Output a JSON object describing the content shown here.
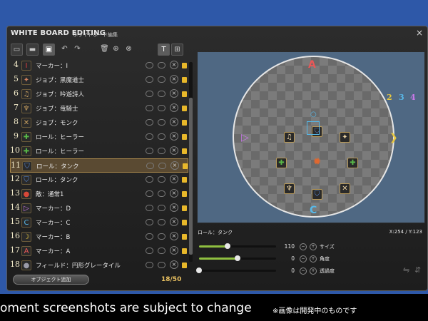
{
  "window": {
    "title_en": "WHITE BOARD EDITING",
    "title_jp": "ホワイトボード編集",
    "close_icon": "×"
  },
  "toolbar": {
    "icons": [
      "save-icon",
      "folder-icon",
      "floppy-icon",
      "undo-icon",
      "redo-icon",
      "trash-icon",
      "copy-icon",
      "paste-icon",
      "text-icon",
      "grid-icon"
    ],
    "text_label": "T"
  },
  "list": {
    "rows": [
      {
        "num": "4",
        "label": "マーカー：Ⅰ",
        "icon": "marker-1-icon",
        "glyph": "Ⅰ",
        "color": "#d84040"
      },
      {
        "num": "5",
        "label": "ジョブ：黒魔道士",
        "icon": "black-mage-icon",
        "glyph": "✦",
        "color": "#d08060"
      },
      {
        "num": "6",
        "label": "ジョブ：吟遊詩人",
        "icon": "bard-icon",
        "glyph": "♫",
        "color": "#c8a060"
      },
      {
        "num": "7",
        "label": "ジョブ：竜騎士",
        "icon": "dragoon-icon",
        "glyph": "♆",
        "color": "#c8a060"
      },
      {
        "num": "8",
        "label": "ジョブ：モンク",
        "icon": "monk-icon",
        "glyph": "✕",
        "color": "#c8a060"
      },
      {
        "num": "9",
        "label": "ロール：ヒーラー",
        "icon": "healer-icon",
        "glyph": "✚",
        "color": "#58b848"
      },
      {
        "num": "10",
        "label": "ロール：ヒーラー",
        "icon": "healer-icon",
        "glyph": "✚",
        "color": "#58b848"
      },
      {
        "num": "11",
        "label": "ロール：タンク",
        "icon": "tank-icon",
        "glyph": "⛉",
        "color": "#5a8ad8"
      },
      {
        "num": "12",
        "label": "ロール：タンク",
        "icon": "tank-icon",
        "glyph": "⛉",
        "color": "#5a8ad8"
      },
      {
        "num": "13",
        "label": "敵：通常1",
        "icon": "enemy-icon",
        "glyph": "●",
        "color": "#d84838"
      },
      {
        "num": "14",
        "label": "マーカー：D",
        "icon": "marker-d-icon",
        "glyph": "▷",
        "color": "#c878e8"
      },
      {
        "num": "15",
        "label": "マーカー：C",
        "icon": "marker-c-icon",
        "glyph": "C",
        "color": "#58b8e8"
      },
      {
        "num": "16",
        "label": "マーカー：B",
        "icon": "marker-b-icon",
        "glyph": "☽",
        "color": "#e8c840"
      },
      {
        "num": "17",
        "label": "マーカー：A",
        "icon": "marker-a-icon",
        "glyph": "A",
        "color": "#e85858"
      },
      {
        "num": "18",
        "label": "フィールド：円形グレータイル",
        "icon": "field-icon",
        "glyph": "●",
        "color": "#9a9aa8"
      }
    ],
    "selected_index": 7,
    "add_button": "オブジェクト追加",
    "count": "18/50"
  },
  "canvas": {
    "legend": [
      {
        "text": "1",
        "color": "#e85878"
      },
      {
        "text": "2",
        "color": "#e8c840"
      },
      {
        "text": "3",
        "color": "#58b8e8"
      },
      {
        "text": "4",
        "color": "#c878e8"
      }
    ],
    "markers": {
      "a": {
        "text": "A",
        "color": "#e85858"
      },
      "b": {
        "text": "❯",
        "color": "#e8c840"
      },
      "c": {
        "text": "C",
        "color": "#58b8e8"
      },
      "d": {
        "text": "▷",
        "color": "#c878e8"
      },
      "ring": {
        "text": "○",
        "color": "#58b8e8"
      }
    },
    "jobs": {
      "bard": "♫",
      "tank_top": "⛉",
      "black_mage": "✦",
      "healer_left": "✚",
      "enemy": "✹",
      "healer_right": "✚",
      "dragoon": "♆",
      "tank_bottom": "⛉",
      "monk": "✕"
    }
  },
  "properties": {
    "name": "ロール：タンク",
    "coords": "X:254 / Y:123",
    "sliders": [
      {
        "label": "サイズ",
        "value": "110",
        "fraction": 0.37
      },
      {
        "label": "角度",
        "value": "0",
        "fraction": 0.5
      },
      {
        "label": "透過度",
        "value": "0",
        "fraction": 0.0
      }
    ],
    "stepper_minus": "−",
    "stepper_plus": "+"
  },
  "footer": {
    "english": "oment screenshots are subject to change",
    "japanese": "※画像は開発中のものです"
  }
}
